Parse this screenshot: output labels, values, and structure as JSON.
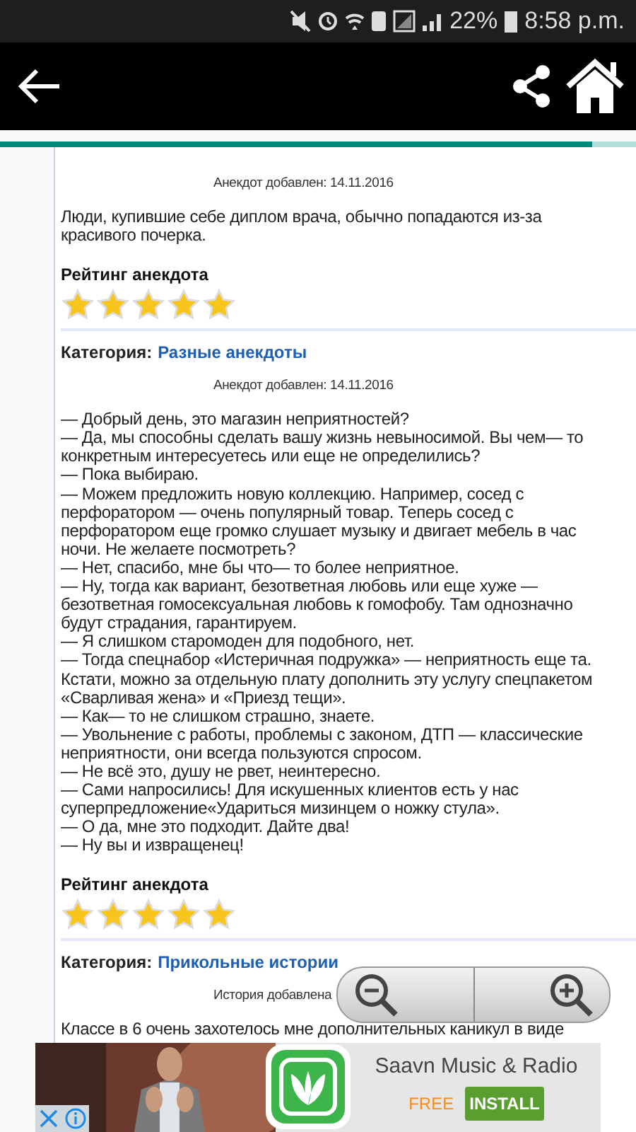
{
  "status_bar": {
    "battery": "22%",
    "time": "8:58 p.m."
  },
  "progress": {
    "level": 0.93
  },
  "articles": [
    {
      "date": "Анекдот добавлен: 14.11.2016",
      "lines": [
        "Люди, купившие себе диплом врача, обычно попадаются из-за красивого почерка."
      ],
      "rating_label": "Рейтинг анекдота",
      "stars": 5
    },
    {
      "category_label": "Категория:",
      "category": "Разные анекдоты",
      "date": "Анекдот добавлен: 14.11.2016",
      "lines": [
        "— Добрый день, это магазин неприятностей?",
        "— Да, мы способны сделать вашу жизнь невыносимой. Вы чем— то конкретным интересуетесь или еще не определились?",
        "— Пока выбираю.",
        "— Можем предложить новую коллекцию. Например, сосед с перфоратором — очень популярный товар. Теперь сосед с перфоратором еще громко слушает музыку и двигает мебель в час ночи. Не желаете посмотреть?",
        "— Нет, спасибо, мне бы что— то более неприятное.",
        "— Ну, тогда как вариант, безответная любовь или еще хуже — безответная гомосексуальная любовь к гомофобу. Там однозначно будут страдания, гарантируем.",
        "— Я слишком старомоден для подобного, нет.",
        "— Тогда спецнабор «Истеричная подружка» — неприятность еще та. Кстати, можно за отдельную плату дополнить эту услугу спецпакетом «Сварливая жена» и «Приезд тещи».",
        "— Как— то не слишком страшно, знаете.",
        "— Увольнение с работы, проблемы с законом, ДТП — классические неприятности, они всегда пользуются спросом.",
        "— Не всё это, душу не рвет, неинтересно.",
        "— Сами напросились! Для искушенных клиентов есть у нас суперпредложение«Удариться мизинцем о ножку стула».",
        "— О да, мне это подходит. Дайте два!",
        "— Ну вы и извращенец!"
      ],
      "rating_label": "Рейтинг анекдота",
      "stars": 5
    },
    {
      "category_label": "Категория:",
      "category": "Прикольные истории",
      "date": "История добавлена",
      "lines": [
        "Классе в 6 очень захотелось мне дополнительных каникул в виде"
      ]
    }
  ],
  "ad": {
    "title": "Saavn Music & Radio",
    "price": "FREE",
    "button": "INSTALL"
  }
}
